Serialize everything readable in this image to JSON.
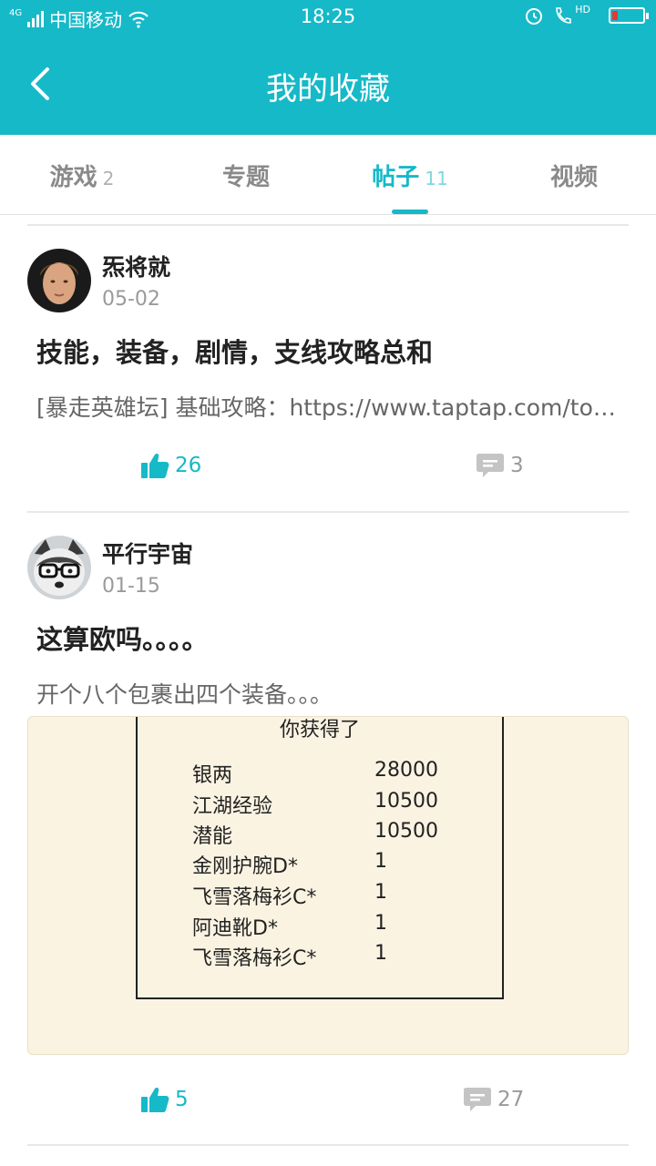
{
  "status_bar": {
    "network": "4G",
    "carrier": "中国移动",
    "time": "18:25",
    "hd": "HD"
  },
  "header": {
    "title": "我的收藏",
    "back_icon": "chevron-left-icon"
  },
  "tabs": [
    {
      "label": "游戏",
      "count": "2",
      "active": false
    },
    {
      "label": "专题",
      "count": "",
      "active": false
    },
    {
      "label": "帖子",
      "count": "11",
      "active": true
    },
    {
      "label": "视频",
      "count": "",
      "active": false
    }
  ],
  "posts": [
    {
      "author": "炁将就",
      "date": "05-02",
      "title": "技能，装备，剧情，支线攻略总和",
      "excerpt": "[暴走英雄坛] 基础攻略：https://www.taptap.com/topic/",
      "likes": "26",
      "comments": "3"
    },
    {
      "author": "平行宇宙",
      "date": "01-15",
      "title": "这算欧吗。。。。",
      "excerpt": "开个八个包裹出四个装备。。。",
      "image": {
        "heading": "你获得了",
        "rows": [
          {
            "name": "银两",
            "qty": "28000"
          },
          {
            "name": "江湖经验",
            "qty": "10500"
          },
          {
            "name": "潜能",
            "qty": "10500"
          },
          {
            "name": "金刚护腕D*",
            "qty": "1"
          },
          {
            "name": "飞雪落梅衫C*",
            "qty": "1"
          },
          {
            "name": "阿迪靴D*",
            "qty": "1"
          },
          {
            "name": "飞雪落梅衫C*",
            "qty": "1"
          }
        ]
      },
      "likes": "5",
      "comments": "27"
    }
  ],
  "colors": {
    "accent": "#16b9c8",
    "text": "#222222",
    "muted": "#9a9a9a"
  }
}
